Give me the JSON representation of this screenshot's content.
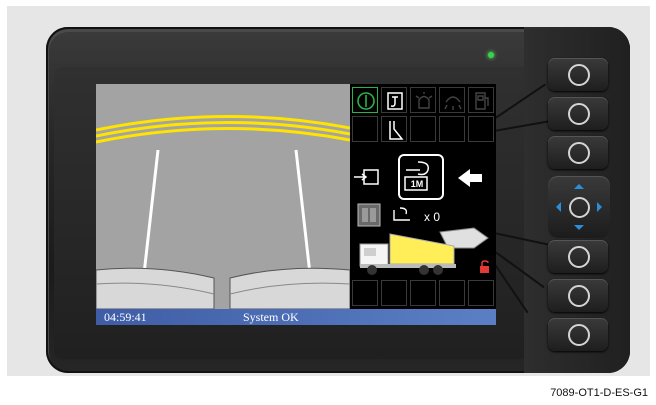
{
  "screen": {
    "status_bar": {
      "time": "04:59:41",
      "status": "System OK"
    },
    "hopper_count": "x 0",
    "hopper_size_label": "1M"
  },
  "hardware": {
    "buttons": [
      "circle-button",
      "circle-button",
      "circle-button",
      "circle-button",
      "circle-button",
      "circle-button"
    ],
    "nav_pad": "arrow-navigation-pad"
  },
  "colors": {
    "active_icon_border": "#2bb24a",
    "status_bar": "#4a6bb5",
    "lane_yellow": "#ffe400",
    "lock_red": "#e53935",
    "led_green": "#39d24a"
  },
  "caption": "7089-OT1-D-ES-G1"
}
